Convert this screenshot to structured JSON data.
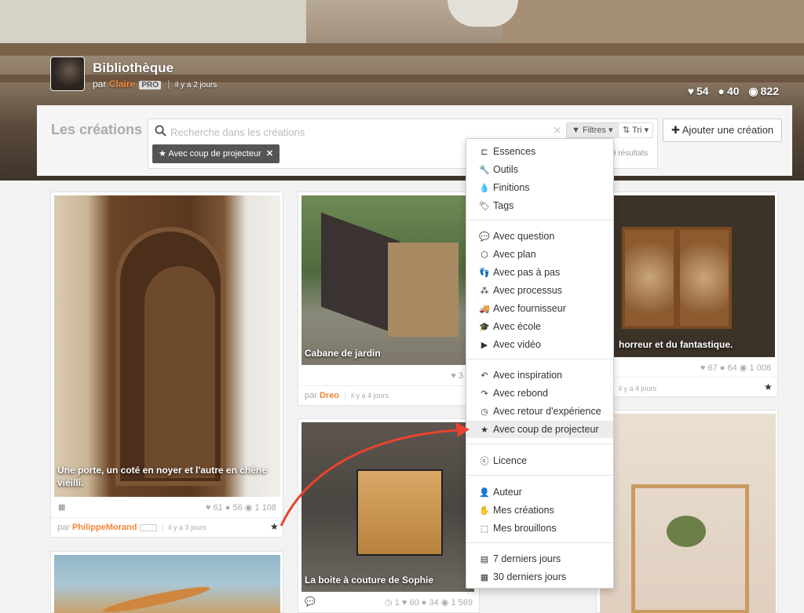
{
  "header": {
    "title": "Bibliothèque",
    "by_prefix": "par",
    "author": "Claire",
    "pro_badge": "PRO",
    "date": "il y a 2 jours",
    "likes": "54",
    "comments": "40",
    "views": "822"
  },
  "toolbar": {
    "section_title": "Les créations",
    "search_placeholder": "Recherche dans les créations",
    "filters_label": "Filtres",
    "sort_label": "Tri",
    "active_filter": "Avec coup de projecteur",
    "results_count": "9 résultats",
    "add_label": "Ajouter une création"
  },
  "cards": [
    {
      "caption": "Une porte, un coté en noyer et l'autre en chêne vieilli.",
      "likes": "61",
      "comments": "56",
      "views": "1 108",
      "by_prefix": "par",
      "author": "PhilippeMorand",
      "date": "il y a 3 jours"
    },
    {
      "caption": "Cabane de jardin",
      "likes": "3",
      "by_prefix": "par",
      "author": "Dreo",
      "date": "il y a 4 jours"
    },
    {
      "caption": "horreur et du fantastique.",
      "likes": "67",
      "comments": "64",
      "views": "1 008",
      "date": "il y a 4 jours"
    },
    {
      "caption": "La boite à couture de Sophie",
      "feedback": "1",
      "likes": "60",
      "comments": "34",
      "views": "1 569"
    }
  ],
  "menu": {
    "group1": [
      "Essences",
      "Outils",
      "Finitions",
      "Tags"
    ],
    "group2": [
      "Avec question",
      "Avec plan",
      "Avec pas à pas",
      "Avec processus",
      "Avec fournisseur",
      "Avec école",
      "Avec vidéo"
    ],
    "group3": [
      "Avec inspiration",
      "Avec rebond",
      "Avec retour d'expérience",
      "Avec coup de projecteur"
    ],
    "group4": [
      "Licence"
    ],
    "group5": [
      "Auteur",
      "Mes créations",
      "Mes brouillons"
    ],
    "group6": [
      "7 derniers jours",
      "30 derniers jours"
    ]
  },
  "colors": {
    "accent": "#f2863a",
    "annotation_arrow": "#e8432e"
  }
}
